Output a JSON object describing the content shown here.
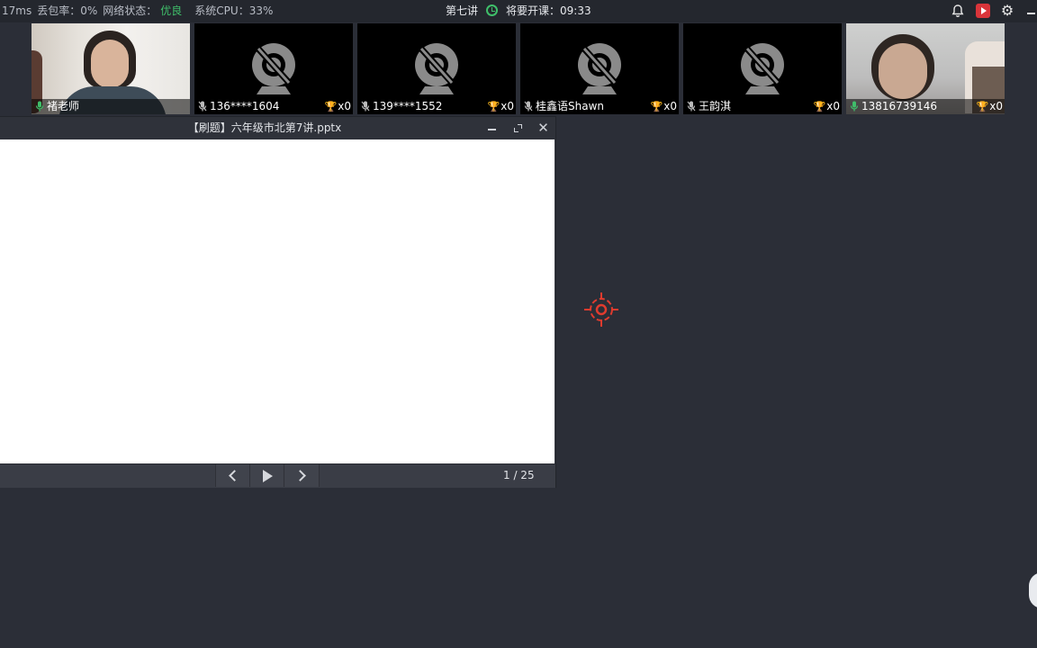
{
  "status": {
    "latency": "17ms",
    "packet_loss": "丢包率：0%",
    "network_label": "网络状态：",
    "network_value": "优良",
    "cpu": "系统CPU：33%"
  },
  "lesson": {
    "title": "第七讲",
    "countdown": "将要开课：09:33"
  },
  "colors": {
    "accent_green": "#3fbf6a",
    "record_red": "#d9343a",
    "pointer_red": "#e03b2e",
    "background": "#2b2e37"
  },
  "participants": [
    {
      "name": "褚老师",
      "camera": "on",
      "mic": "on",
      "trophies": ""
    },
    {
      "name": "136****1604",
      "camera": "off",
      "mic": "off",
      "trophies": "x0"
    },
    {
      "name": "139****1552",
      "camera": "off",
      "mic": "off",
      "trophies": "x0"
    },
    {
      "name": "桂鑫语Shawn",
      "camera": "off",
      "mic": "off",
      "trophies": "x0"
    },
    {
      "name": "王韵淇",
      "camera": "off",
      "mic": "off",
      "trophies": "x0"
    },
    {
      "name": "13816739146",
      "camera": "on",
      "mic": "on",
      "trophies": "x0"
    }
  ],
  "document": {
    "title": "【刷题】六年级市北第7讲.pptx",
    "page": "1 / 25"
  },
  "icons": {
    "bell": "bell-icon",
    "record": "record-icon",
    "settings": "gear-icon",
    "minimize": "minimize-icon",
    "camera_off": "camera-off-icon",
    "trophy": "trophy-icon",
    "laser": "laser-pointer-icon"
  }
}
